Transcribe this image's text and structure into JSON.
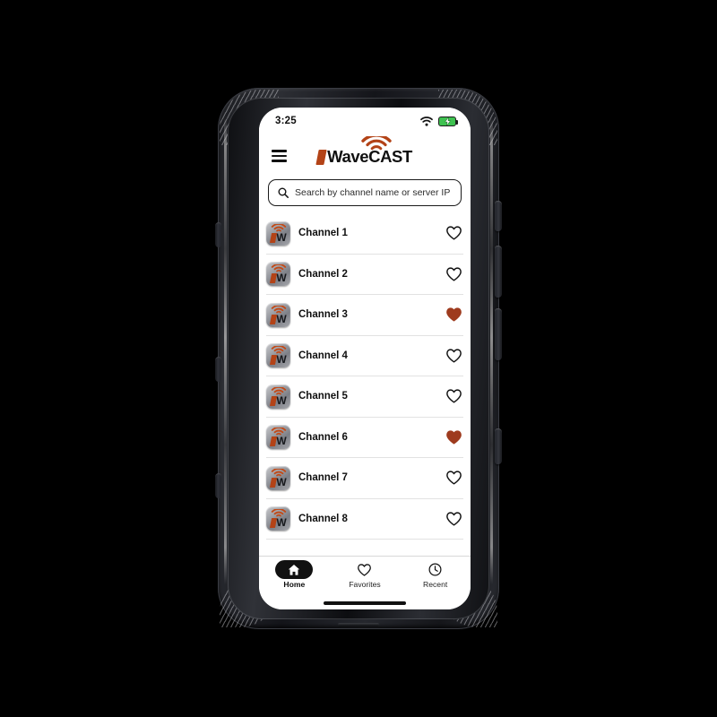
{
  "status_bar": {
    "time": "3:25",
    "wifi_icon": "wifi-icon",
    "battery_icon": "battery-charging-icon",
    "battery_color": "#3EC250"
  },
  "header": {
    "menu_icon": "hamburger-menu-icon",
    "brand_name": "WaveCAST",
    "brand_wifi_icon": "wifi-arc-icon",
    "brand_color": "#B34317"
  },
  "search": {
    "icon": "search-icon",
    "placeholder": "Search by channel name or server IP",
    "value": ""
  },
  "channels": [
    {
      "name": "Channel 1",
      "favorite": false,
      "icon": "wavecast-app-icon"
    },
    {
      "name": "Channel 2",
      "favorite": false,
      "icon": "wavecast-app-icon"
    },
    {
      "name": "Channel 3",
      "favorite": true,
      "icon": "wavecast-app-icon"
    },
    {
      "name": "Channel 4",
      "favorite": false,
      "icon": "wavecast-app-icon"
    },
    {
      "name": "Channel 5",
      "favorite": false,
      "icon": "wavecast-app-icon"
    },
    {
      "name": "Channel 6",
      "favorite": true,
      "icon": "wavecast-app-icon"
    },
    {
      "name": "Channel 7",
      "favorite": false,
      "icon": "wavecast-app-icon"
    },
    {
      "name": "Channel 8",
      "favorite": false,
      "icon": "wavecast-app-icon"
    }
  ],
  "favorite_colors": {
    "filled": "#9E3B1E",
    "outline": "#101010"
  },
  "bottom_nav": {
    "items": [
      {
        "label": "Home",
        "icon": "home-icon",
        "active": true
      },
      {
        "label": "Favorites",
        "icon": "heart-icon",
        "active": false
      },
      {
        "label": "Recent",
        "icon": "clock-icon",
        "active": false
      }
    ]
  }
}
